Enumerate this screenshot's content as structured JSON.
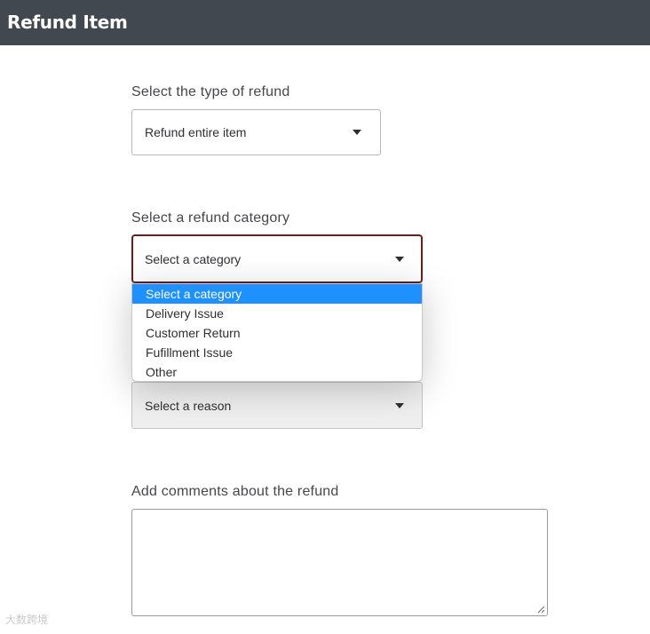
{
  "header": {
    "title": "Refund Item"
  },
  "refund_type": {
    "label": "Select the type of refund",
    "value": "Refund entire item"
  },
  "refund_category": {
    "label": "Select a refund category",
    "value": "Select a category",
    "options": [
      "Select a category",
      "Delivery Issue",
      "Customer Return",
      "Fufillment Issue",
      "Other"
    ],
    "highlighted_option": "Select a category"
  },
  "refund_reason": {
    "value": "Select a reason"
  },
  "comments": {
    "label": "Add comments about the refund",
    "value": ""
  },
  "watermark": {
    "text": "大数跨境"
  },
  "colors": {
    "header_bg": "#41484f",
    "highlight": "#1e90ff",
    "focus_border": "#6b1c1c"
  }
}
